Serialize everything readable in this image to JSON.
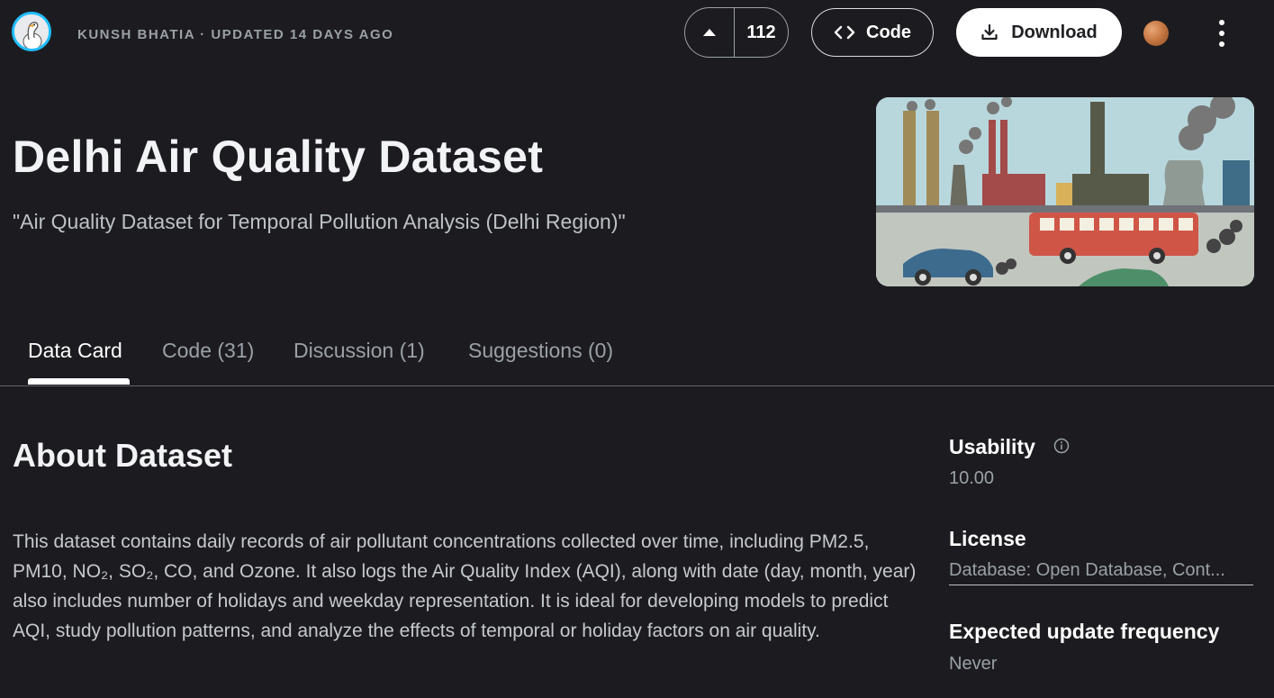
{
  "header": {
    "byline": "KUNSH BHATIA · UPDATED 14 DAYS AGO",
    "vote_count": "112",
    "code_label": "Code",
    "download_label": "Download"
  },
  "dataset": {
    "title": "Delhi Air Quality Dataset",
    "subtitle": "\"Air Quality Dataset for Temporal Pollution Analysis (Delhi Region)\""
  },
  "tabs": [
    {
      "label": "Data Card",
      "active": true
    },
    {
      "label": "Code (31)",
      "active": false
    },
    {
      "label": "Discussion (1)",
      "active": false
    },
    {
      "label": "Suggestions (0)",
      "active": false
    }
  ],
  "about": {
    "heading": "About Dataset",
    "description": "This dataset contains daily records of air pollutant concentrations collected over time, including PM2.5, PM10, NO₂, SO₂, CO, and Ozone. It also logs the Air Quality Index (AQI), along with date (day, month, year) also includes number of holidays and weekday representation. It is ideal for developing models to predict AQI, study pollution patterns, and analyze the effects of temporal or holiday factors on air quality."
  },
  "sidebar": {
    "usability_label": "Usability",
    "usability_value": "10.00",
    "license_label": "License",
    "license_value": "Database: Open Database, Cont...",
    "frequency_label": "Expected update frequency",
    "frequency_value": "Never"
  },
  "colors": {
    "background": "#1c1c20",
    "avatar_ring": "#20beff",
    "text_primary": "#ffffff",
    "text_secondary": "#9aa0a6"
  },
  "icons": {
    "upvote": "caret-up-icon",
    "code": "code-brackets-icon",
    "download": "download-icon",
    "medal": "bronze-medal-icon",
    "more": "kebab-menu-icon",
    "info": "info-icon"
  }
}
